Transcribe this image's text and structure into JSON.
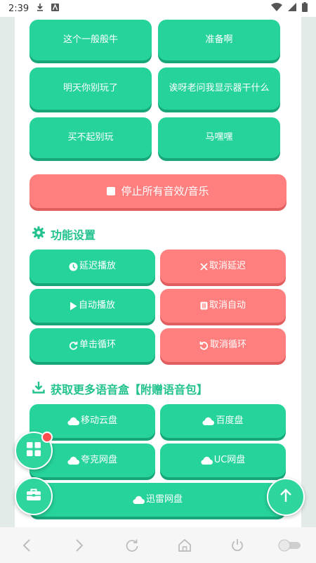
{
  "status": {
    "time": "2:39"
  },
  "sounds": [
    "这个一般般牛",
    "准备啊",
    "明天你别玩了",
    "诶呀老问我显示器干什么",
    "买不起别玩",
    "马嘿嘿"
  ],
  "stop_all": "停止所有音效/音乐",
  "settings": {
    "title": "功能设置",
    "delay": "延迟播放",
    "cancel_delay": "取消延迟",
    "auto": "自动播放",
    "cancel_auto": "取消自动",
    "loop": "单击循环",
    "cancel_loop": "取消循环"
  },
  "download": {
    "title": "获取更多语音盒【附赠语音包】",
    "mobile_cloud": "移动云盘",
    "baidu": "百度盘",
    "quark": "夸克网盘",
    "uc": "UC网盘",
    "xunlei": "迅雷网盘"
  },
  "colors": {
    "green": "#26d39b",
    "red": "#ff7f7f",
    "accent": "#22c28e"
  }
}
